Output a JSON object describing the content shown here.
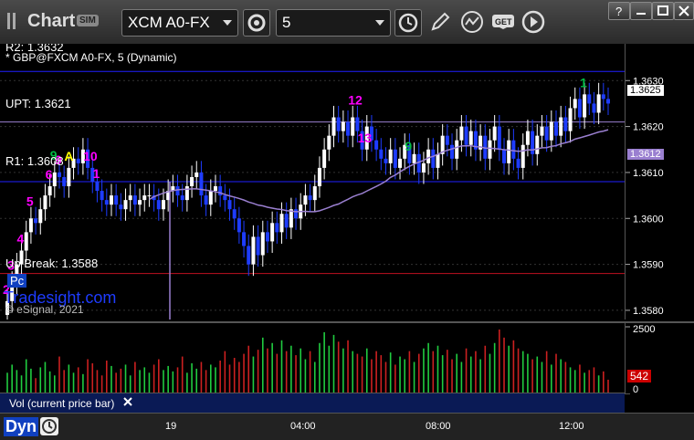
{
  "toolbar": {
    "app_title": "Chart",
    "sim_badge": "SIM",
    "symbol": "XCM A0-FX",
    "interval": "5"
  },
  "chart": {
    "study_title": "* GBP@FXCM A0-FX, 5 (Dynamic)",
    "r2_label": "R2: 1.3632",
    "upt_label": "UPT: 1.3621",
    "r1_label": "R1: 1.3608",
    "breakout_label": "Up Break: 1.3588",
    "watermark": "Tradesight.com",
    "copyright": "© eSignal, 2021",
    "p_badge": "Pc",
    "last_price": "1.3625",
    "ma_value": "1.3612",
    "colors": {
      "up": "#ffffff",
      "down": "#1e3cff",
      "ma": "#9a7fd0",
      "r_line": "#2020ff",
      "upt_line": "#9a7fd0",
      "break_line": "#c01020"
    }
  },
  "chart_data": [
    {
      "type": "candlestick",
      "title": "GBP@FXCM A0-FX, 5 (Dynamic)",
      "ylim": [
        1.3578,
        1.3638
      ],
      "yticks": [
        "1.3630",
        "1.3620",
        "1.3610",
        "1.3600",
        "1.3590",
        "1.3580"
      ],
      "xticks": [
        "19",
        "04:00",
        "08:00",
        "12:00"
      ],
      "levels": [
        {
          "name": "R2",
          "value": 1.3632
        },
        {
          "name": "UPT",
          "value": 1.3621
        },
        {
          "name": "R1",
          "value": 1.3608
        },
        {
          "name": "Up Break",
          "value": 1.3588
        }
      ],
      "close": [
        1.3582,
        1.3586,
        1.359,
        1.3593,
        1.3597,
        1.36,
        1.3599,
        1.3602,
        1.3605,
        1.3607,
        1.361,
        1.3609,
        1.3607,
        1.3611,
        1.3613,
        1.3612,
        1.3615,
        1.3611,
        1.3608,
        1.3606,
        1.3604,
        1.3603,
        1.3605,
        1.3603,
        1.3602,
        1.3604,
        1.3605,
        1.3603,
        1.3604,
        1.3605,
        1.3605,
        1.3604,
        1.3602,
        1.3604,
        1.3606,
        1.3607,
        1.3605,
        1.3604,
        1.3607,
        1.3609,
        1.361,
        1.3605,
        1.3603,
        1.3606,
        1.3607,
        1.3605,
        1.3604,
        1.3602,
        1.36,
        1.3597,
        1.3594,
        1.359,
        1.3596,
        1.3592,
        1.3597,
        1.3595,
        1.3599,
        1.3597,
        1.3601,
        1.3598,
        1.3602,
        1.36,
        1.3603,
        1.3605,
        1.3604,
        1.3607,
        1.3611,
        1.3615,
        1.3618,
        1.3622,
        1.3619,
        1.3621,
        1.3618,
        1.3622,
        1.3619,
        1.3615,
        1.362,
        1.3617,
        1.3615,
        1.3613,
        1.3612,
        1.3615,
        1.3611,
        1.3613,
        1.3616,
        1.3612,
        1.3614,
        1.361,
        1.3612,
        1.3615,
        1.3611,
        1.3614,
        1.3618,
        1.3616,
        1.3613,
        1.3617,
        1.362,
        1.3616,
        1.3619,
        1.3615,
        1.3618,
        1.3613,
        1.3617,
        1.362,
        1.3615,
        1.3612,
        1.3617,
        1.3613,
        1.3611,
        1.3616,
        1.3619,
        1.3614,
        1.3618,
        1.362,
        1.3617,
        1.3621,
        1.3618,
        1.3622,
        1.3619,
        1.3624,
        1.3626,
        1.3622,
        1.3627,
        1.3625,
        1.3623,
        1.3627,
        1.3626,
        1.3625
      ],
      "moving_average_last": 1.3612,
      "markers": [
        {
          "text": "12",
          "color": "#ff00ff"
        },
        {
          "text": "13",
          "color": "#ff00ff"
        },
        {
          "text": "1",
          "color": "#ff00ff"
        },
        {
          "text": "10",
          "color": "#ff00ff"
        },
        {
          "text": "9",
          "color": "#ff00ff"
        },
        {
          "text": "A",
          "color": "#ffff00"
        },
        {
          "text": "5",
          "color": "#ff00ff"
        },
        {
          "text": "6",
          "color": "#ff00ff"
        },
        {
          "text": "9",
          "color": "#00bb44"
        },
        {
          "text": "4",
          "color": "#ff00ff"
        },
        {
          "text": "3",
          "color": "#ff00ff"
        },
        {
          "text": "2",
          "color": "#ff00ff"
        },
        {
          "text": "9",
          "color": "#00bb44"
        },
        {
          "text": "1",
          "color": "#00bb44"
        }
      ]
    },
    {
      "type": "bar",
      "title": "Vol (current price bar)",
      "ylim": [
        0,
        2500
      ],
      "yticks": [
        "2500",
        "0"
      ],
      "last_value": 542,
      "values": [
        800,
        1100,
        900,
        700,
        1300,
        950,
        600,
        1000,
        1200,
        850,
        700,
        1400,
        900,
        1100,
        800,
        1000,
        750,
        1300,
        1150,
        900,
        700,
        1250,
        1050,
        800,
        950,
        1100,
        700,
        1200,
        900,
        1000,
        800,
        1100,
        1300,
        900,
        1050,
        850,
        1000,
        1400,
        800,
        1150,
        950,
        1200,
        900,
        1100,
        1000,
        1250,
        1600,
        1100,
        1350,
        1200,
        1500,
        1800,
        1400,
        1650,
        2100,
        1700,
        1900,
        1500,
        2000,
        1600,
        1800,
        1450,
        1700,
        1300,
        1600,
        1200,
        1900,
        2300,
        1800,
        2200,
        1950,
        1700,
        2000,
        1600,
        1500,
        1400,
        1700,
        1300,
        1600,
        1450,
        1200,
        1550,
        1100,
        1400,
        1300,
        1600,
        1200,
        1500,
        1700,
        1900,
        1600,
        1800,
        1450,
        1650,
        1300,
        1500,
        1200,
        1700,
        1400,
        1600,
        1300,
        1800,
        1500,
        1900,
        2400,
        2100,
        1800,
        2000,
        1700,
        1600,
        1500,
        1300,
        1400,
        1200,
        1600,
        1100,
        1500,
        1300,
        1200,
        1000,
        900,
        1100,
        800,
        900,
        1000,
        700,
        850,
        542
      ],
      "down_color": "#cc2020",
      "up_color": "#20cc40"
    }
  ],
  "volpanel": {
    "label": "Vol (current price bar)",
    "vol_last": "542"
  },
  "bottom": {
    "dyn_label": "Dyn",
    "times": [
      "19",
      "04:00",
      "08:00",
      "12:00"
    ]
  }
}
